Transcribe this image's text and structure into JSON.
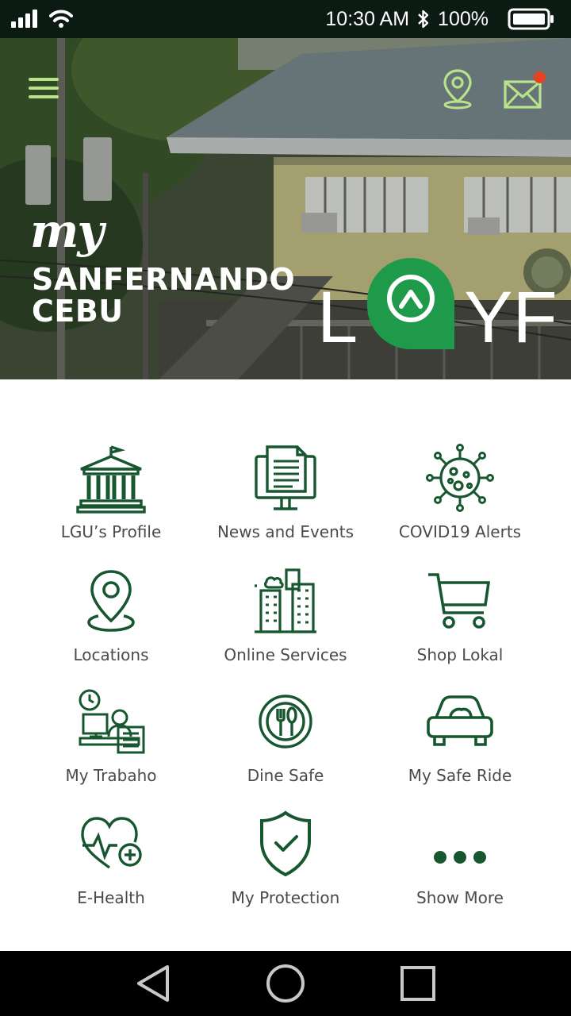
{
  "status_bar": {
    "time": "10:30 AM",
    "battery": "100%",
    "icons": [
      "signal-icon",
      "wifi-icon",
      "bluetooth-icon",
      "battery-icon"
    ]
  },
  "header": {
    "menu_icon": "hamburger-menu-icon",
    "location_icon": "map-pin-icon",
    "mail_icon": "mail-icon",
    "accent_color": "#b7e38a",
    "notification_color": "#e8411f"
  },
  "brand": {
    "my": "my",
    "city_line1": "SANFERNANDO",
    "city_line2": "CEBU",
    "loyf_l": "L",
    "loyf_yf": "YF",
    "badge_color": "#1e9a4a"
  },
  "menu": [
    {
      "label": "LGU’s Profile",
      "icon": "government-building-icon"
    },
    {
      "label": "News and Events",
      "icon": "newspaper-icon"
    },
    {
      "label": "COVID19 Alerts",
      "icon": "virus-icon"
    },
    {
      "label": "Locations",
      "icon": "location-pin-icon"
    },
    {
      "label": "Online Services",
      "icon": "city-buildings-icon"
    },
    {
      "label": "Shop Lokal",
      "icon": "shopping-cart-icon"
    },
    {
      "label": "My Trabaho",
      "icon": "worker-desk-icon"
    },
    {
      "label": "Dine Safe",
      "icon": "plate-utensils-icon"
    },
    {
      "label": "My Safe Ride",
      "icon": "car-icon"
    },
    {
      "label": "E-Health",
      "icon": "heart-health-icon"
    },
    {
      "label": "My Protection",
      "icon": "shield-check-icon"
    },
    {
      "label": "Show More",
      "icon": "more-dots-icon"
    }
  ],
  "icon_color": "#17572f",
  "nav": [
    "back-icon",
    "home-icon",
    "recents-icon"
  ]
}
